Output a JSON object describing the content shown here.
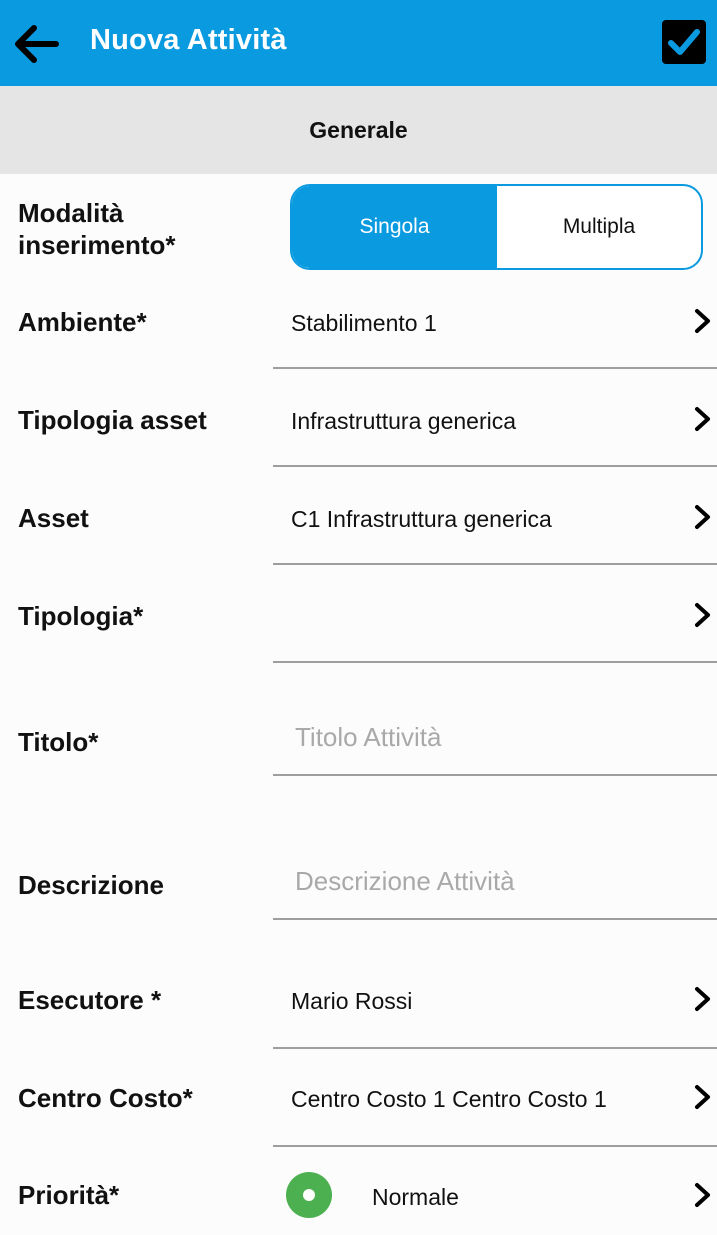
{
  "appbar": {
    "title": "Nuova Attività",
    "back_icon": "arrow-left-icon",
    "confirm_icon": "checkbox-checked-icon",
    "color": "#0a9ae0"
  },
  "section": {
    "title": "Generale"
  },
  "form": {
    "modalita": {
      "label": "Modalità inserimento*",
      "label_line1": "Modalità",
      "label_line2": "inserimento*",
      "options": [
        "Singola",
        "Multipla"
      ],
      "selected": "Singola"
    },
    "ambiente": {
      "label": "Ambiente*",
      "value": "Stabilimento 1"
    },
    "tipologia_asset": {
      "label": "Tipologia asset",
      "value": "Infrastruttura generica"
    },
    "asset": {
      "label": "Asset",
      "value": "C1 Infrastruttura generica"
    },
    "tipologia": {
      "label": "Tipologia*",
      "value": ""
    },
    "titolo": {
      "label": "Titolo*",
      "value": "",
      "placeholder": "Titolo Attività"
    },
    "descrizione": {
      "label": "Descrizione",
      "value": "",
      "placeholder": "Descrizione Attività"
    },
    "esecutore": {
      "label": "Esecutore *",
      "value": "Mario Rossi"
    },
    "centro_costo": {
      "label": "Centro Costo*",
      "value": "Centro Costo 1 Centro Costo 1"
    },
    "priorita": {
      "label": "Priorità*",
      "value": "Normale",
      "indicator_color": "#4cb050"
    }
  }
}
